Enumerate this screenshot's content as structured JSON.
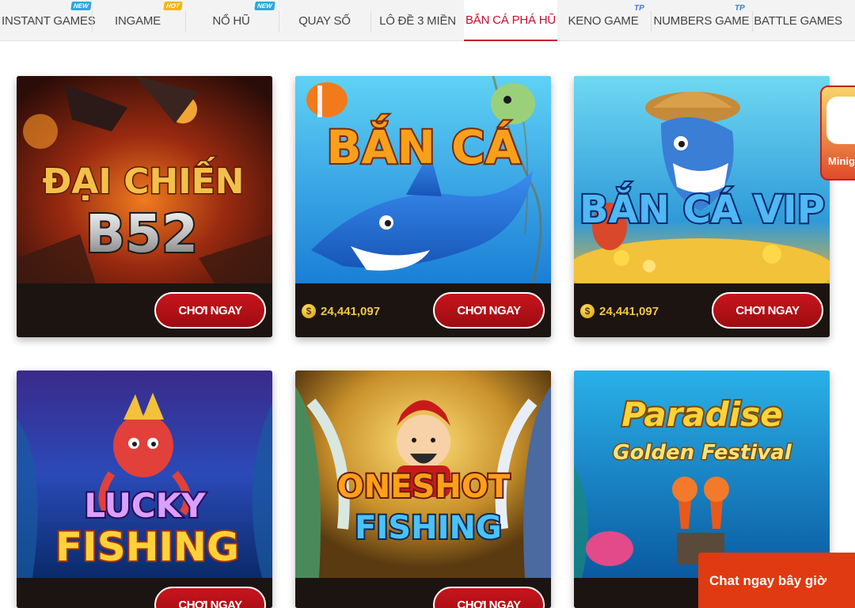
{
  "nav": {
    "items": [
      {
        "label": "INSTANT GAMES",
        "badge": "NEW"
      },
      {
        "label": "INGAME",
        "badge": "HOT"
      },
      {
        "label": "NỔ HŨ",
        "badge": "NEW"
      },
      {
        "label": "QUAY SỐ",
        "badge": ""
      },
      {
        "label": "LÔ ĐỀ 3 MIỀN",
        "badge": ""
      },
      {
        "label": "BẮN CÁ PHÁ HŨ",
        "badge": ""
      },
      {
        "label": "KENO GAME",
        "badge": "TP"
      },
      {
        "label": "NUMBERS GAME",
        "badge": "TP"
      },
      {
        "label": "BATTLE GAMES",
        "badge": ""
      }
    ],
    "active_index": 5
  },
  "games": [
    {
      "art_line1": "ĐẠI CHIẾN",
      "art_line2": "B52",
      "jackpot": "",
      "play_label": "CHƠI NGAY"
    },
    {
      "art_line1": "BẮN CÁ",
      "art_line2": "",
      "jackpot": "24,441,097",
      "play_label": "CHƠI NGAY"
    },
    {
      "art_line1": "BẮN CÁ VIP",
      "art_line2": "",
      "jackpot": "24,441,097",
      "play_label": "CHƠI NGAY"
    },
    {
      "art_line1": "LUCKY",
      "art_line2": "FISHING",
      "jackpot": "",
      "play_label": "CHƠI NGAY"
    },
    {
      "art_line1": "ONESHOT",
      "art_line2": "FISHING",
      "jackpot": "",
      "play_label": "CHƠI NGAY"
    },
    {
      "art_line1": "Paradise",
      "art_line2": "Golden Festival",
      "jackpot": "",
      "play_label": ""
    }
  ],
  "coin_symbol": "$",
  "mini_game": {
    "label": "Minig"
  },
  "chat": {
    "label": "Chat ngay bây giờ"
  },
  "colors": {
    "accent": "#c8102e",
    "button": "#b5111a",
    "chat": "#e03a12",
    "jackpot": "#f0c64a"
  }
}
